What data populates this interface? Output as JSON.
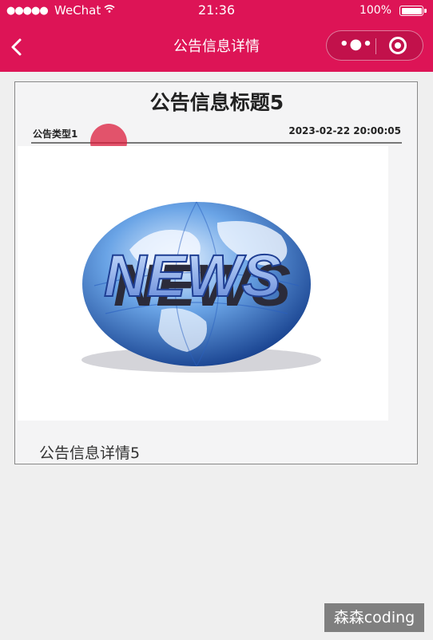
{
  "status_bar": {
    "signal": "●●●●●",
    "carrier": "WeChat",
    "time": "21:36",
    "battery": "100%"
  },
  "nav": {
    "back_icon": "chevron-left-icon",
    "title": "公告信息详情",
    "menu_icon": "more-dots-icon",
    "close_icon": "target-icon"
  },
  "notice": {
    "title": "公告信息标题5",
    "type": "公告类型1",
    "date": "2023-02-22 20:00:05",
    "image_text": "NEWS",
    "description": "公告信息详情5"
  },
  "watermark": "森森coding",
  "colors": {
    "header": "#dd1456",
    "background": "#efefef"
  }
}
